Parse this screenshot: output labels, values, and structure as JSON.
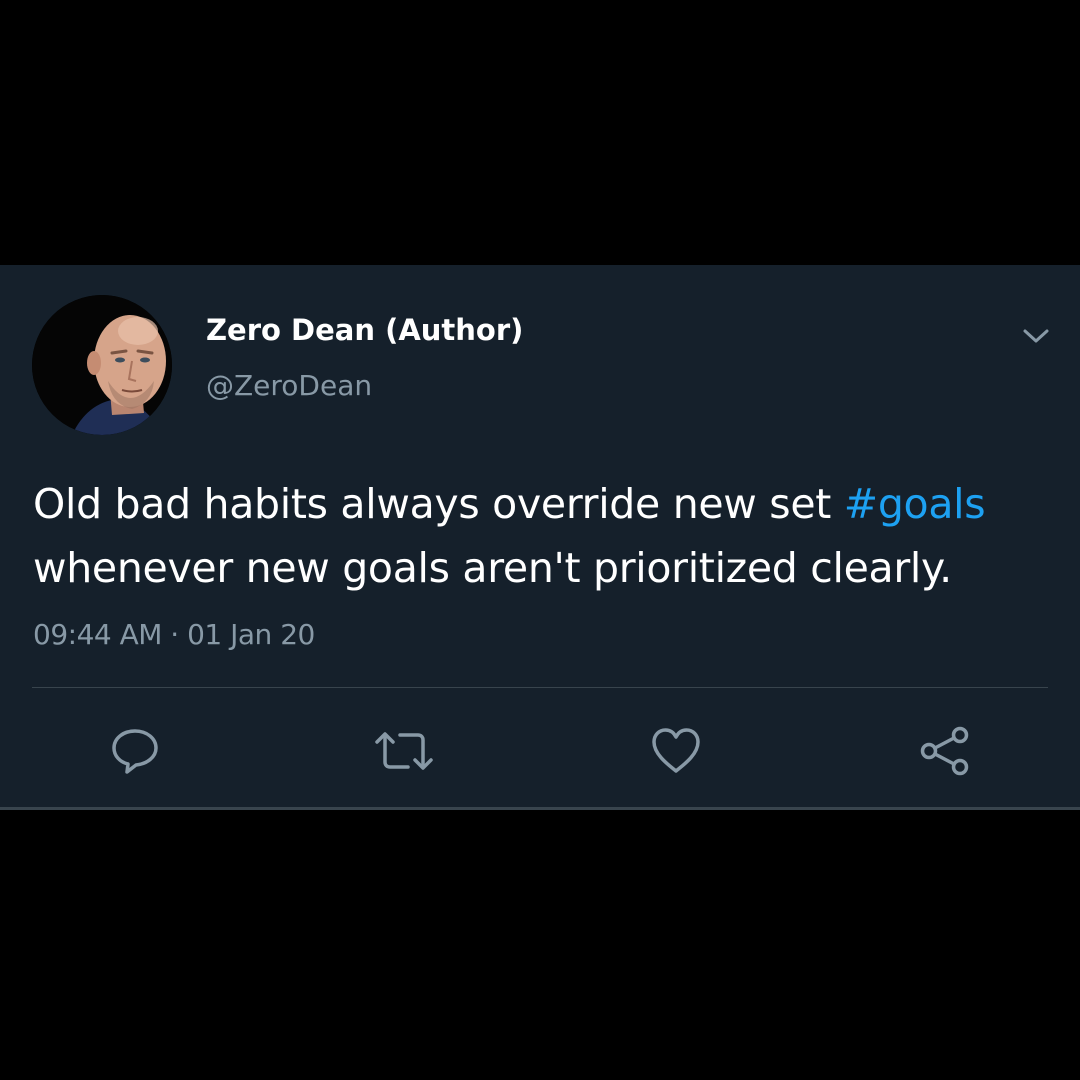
{
  "tweet": {
    "author": {
      "display_name": "Zero Dean (Author)",
      "handle": "@ZeroDean",
      "avatar_icon": "profile-photo"
    },
    "text": {
      "line1_prefix": "Old bad habits always override new set ",
      "hashtag": "#goals",
      "line2": "whenever new goals aren't prioritized clearly."
    },
    "timestamp": "09:44 AM · 01 Jan 20",
    "menu_icon": "chevron-down-icon",
    "actions": [
      {
        "icon": "reply-icon"
      },
      {
        "icon": "retweet-icon"
      },
      {
        "icon": "like-icon"
      },
      {
        "icon": "share-icon"
      }
    ]
  },
  "colors": {
    "background": "#000000",
    "card": "#15202b",
    "text_primary": "#ffffff",
    "text_secondary": "#8899a6",
    "hashtag": "#1da1f2",
    "divider": "#38444d"
  }
}
